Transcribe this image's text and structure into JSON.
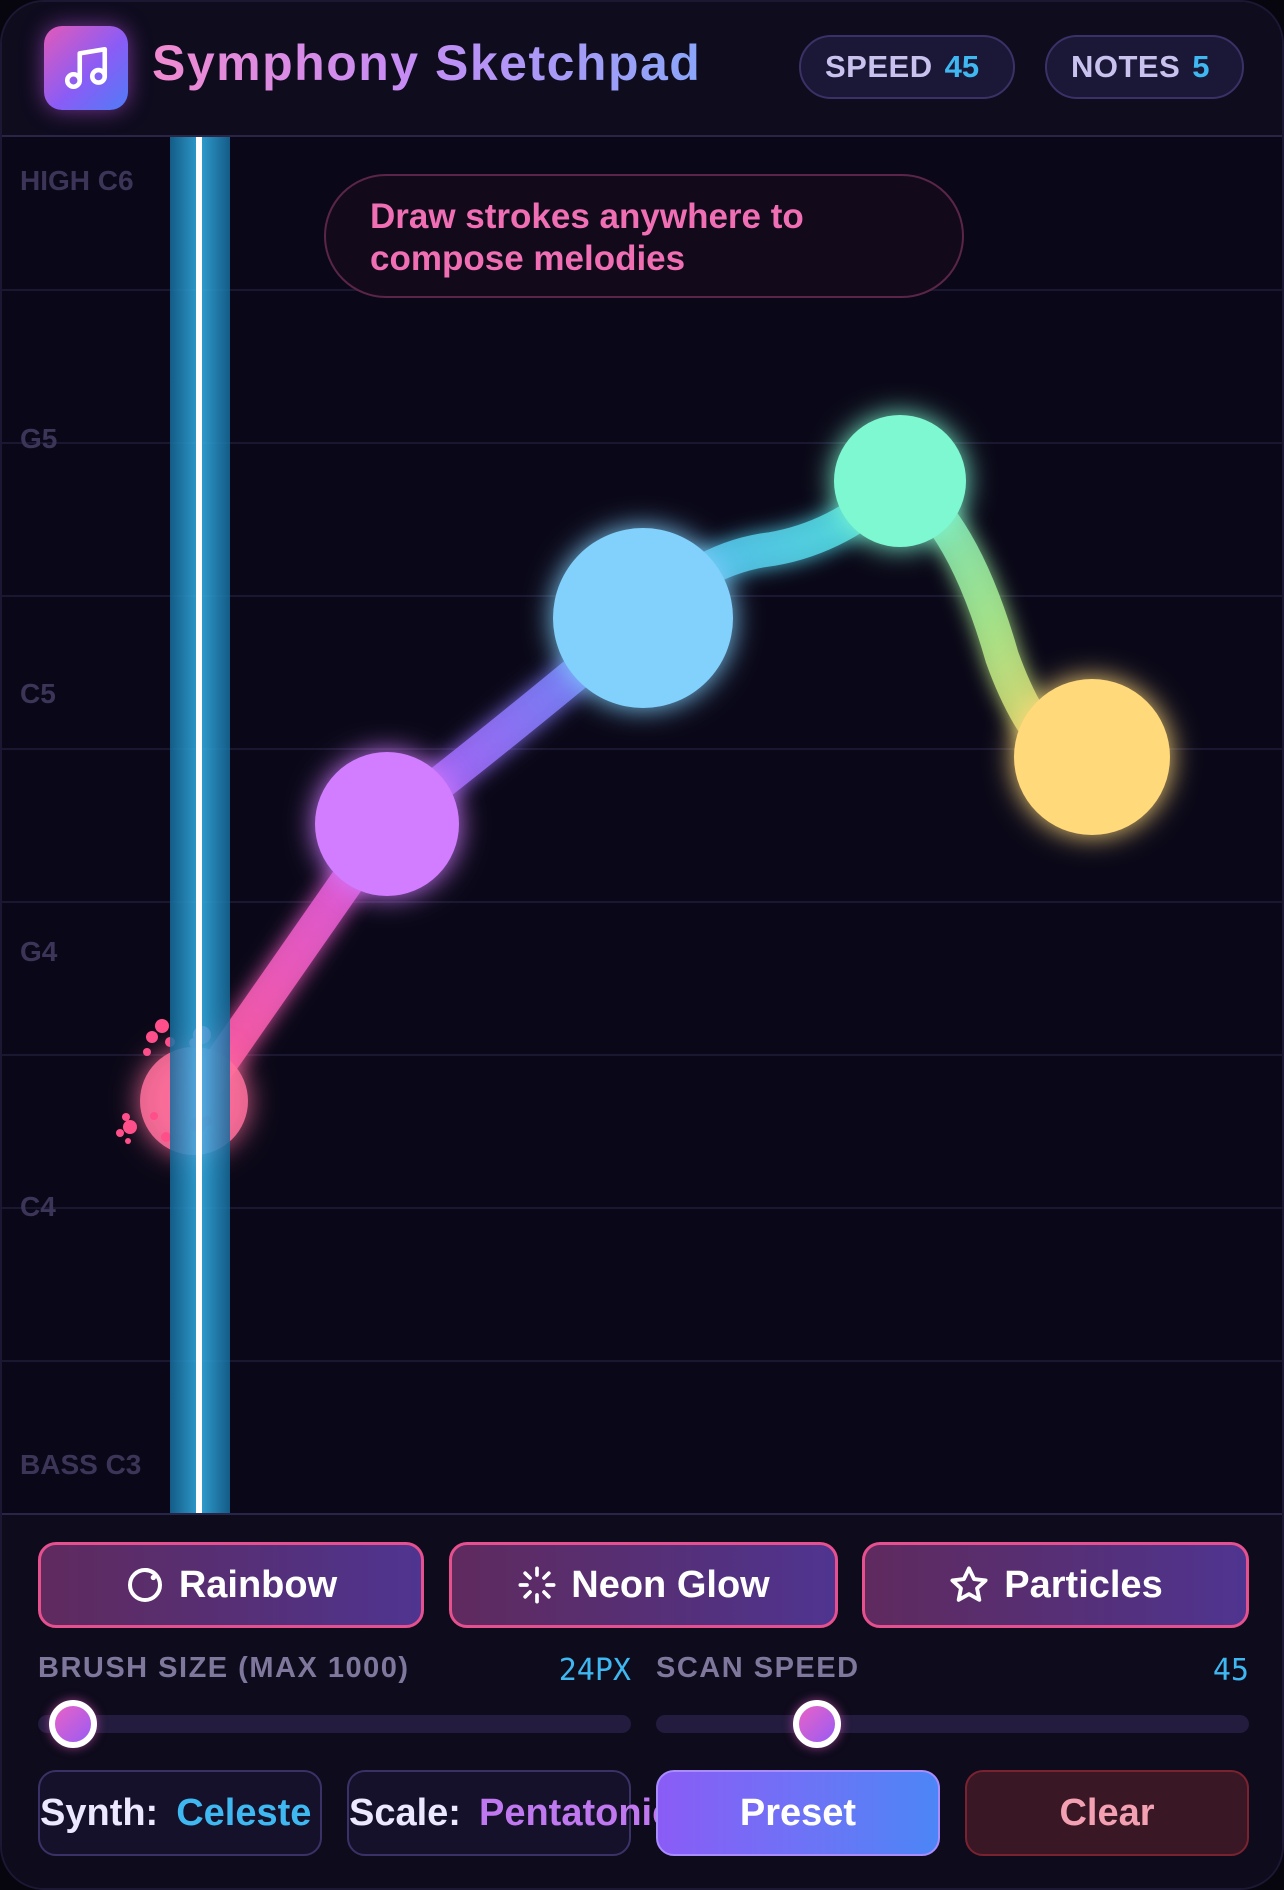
{
  "header": {
    "title": "Symphony Sketchpad",
    "logo_icon": "music-note-icon",
    "speed_label": "SPEED",
    "speed_value": "45",
    "notes_label": "NOTES",
    "notes_value": "5"
  },
  "canvas": {
    "hint_line1": "Draw strokes anywhere to",
    "hint_line2": "compose melodies",
    "pitch_labels": [
      "HIGH C6",
      "G5",
      "C5",
      "G4",
      "C4",
      "BASS C3"
    ],
    "notes": [
      {
        "pitch": "between G4 and C4",
        "color": "#ff6f9c"
      },
      {
        "pitch": "above G4",
        "color": "#d27cff"
      },
      {
        "pitch": "between G5 and C5",
        "color": "#82d1fd"
      },
      {
        "pitch": "G5",
        "color": "#7ef8d0"
      },
      {
        "pitch": "C5",
        "color": "#ffd97a"
      }
    ]
  },
  "effects": {
    "rainbow": "Rainbow",
    "rainbow_icon": "circle-refresh-icon",
    "neon_glow": "Neon Glow",
    "neon_glow_icon": "loader-sparkle-icon",
    "particles": "Particles",
    "particles_icon": "star-icon"
  },
  "controls": {
    "brush_size_label": "BRUSH SIZE (MAX 1000)",
    "brush_size_value": "24PX",
    "brush_size_fraction": 0.024,
    "scan_speed_label": "SCAN SPEED",
    "scan_speed_value": "45"
  },
  "footer": {
    "synth_label": "Synth:",
    "synth_value": "Celeste",
    "scale_label": "Scale:",
    "scale_value": "Pentatonic",
    "preset_label": "Preset",
    "clear_label": "Clear"
  },
  "colors": {
    "accent_cyan": "#3fb8f2",
    "accent_pink": "#e6508f",
    "accent_purple": "#c78cf4",
    "background": "#0a0818"
  }
}
